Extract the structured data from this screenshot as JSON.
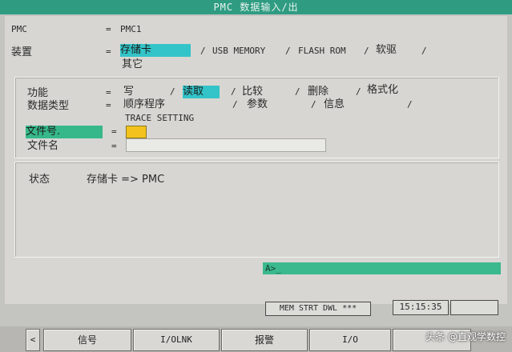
{
  "title": "PMC 数据输入/出",
  "pmc": {
    "label": "PMC",
    "eq": "=",
    "value": "PMC1"
  },
  "device": {
    "label": "装置",
    "eq": "=",
    "options": [
      "存储卡",
      "USB MEMORY",
      "FLASH ROM",
      "软驱",
      "其它"
    ],
    "separator": "/"
  },
  "function": {
    "label": "功能",
    "eq": "=",
    "options": [
      "写",
      "读取",
      "比较",
      "删除",
      "格式化"
    ],
    "separator": "/"
  },
  "data_type": {
    "label": "数据类型",
    "eq": "=",
    "options": [
      "顺序程序",
      "参数",
      "信息",
      "TRACE SETTING"
    ],
    "separator": "/"
  },
  "file_no": {
    "label": "文件号.",
    "eq": "=",
    "value": ""
  },
  "file_name": {
    "label": "文件名",
    "eq": "=",
    "value": ""
  },
  "status": {
    "label": "状态",
    "value": "存储卡 => PMC"
  },
  "command_line": {
    "prompt": "A>_"
  },
  "status_bar": {
    "mode": "MEM  STRT DWL ***",
    "time": "15:15:35"
  },
  "softkeys": {
    "left_arrow": "<",
    "items": [
      "信号",
      "I/OLNK",
      "报警",
      "I/O",
      ""
    ]
  },
  "watermark": "头条 @直观学数控",
  "colors": {
    "title_bar": "#2f9c82",
    "highlight_cyan": "#32c4c8",
    "highlight_green": "#36b88a",
    "cursor_yellow": "#f3c21c"
  }
}
